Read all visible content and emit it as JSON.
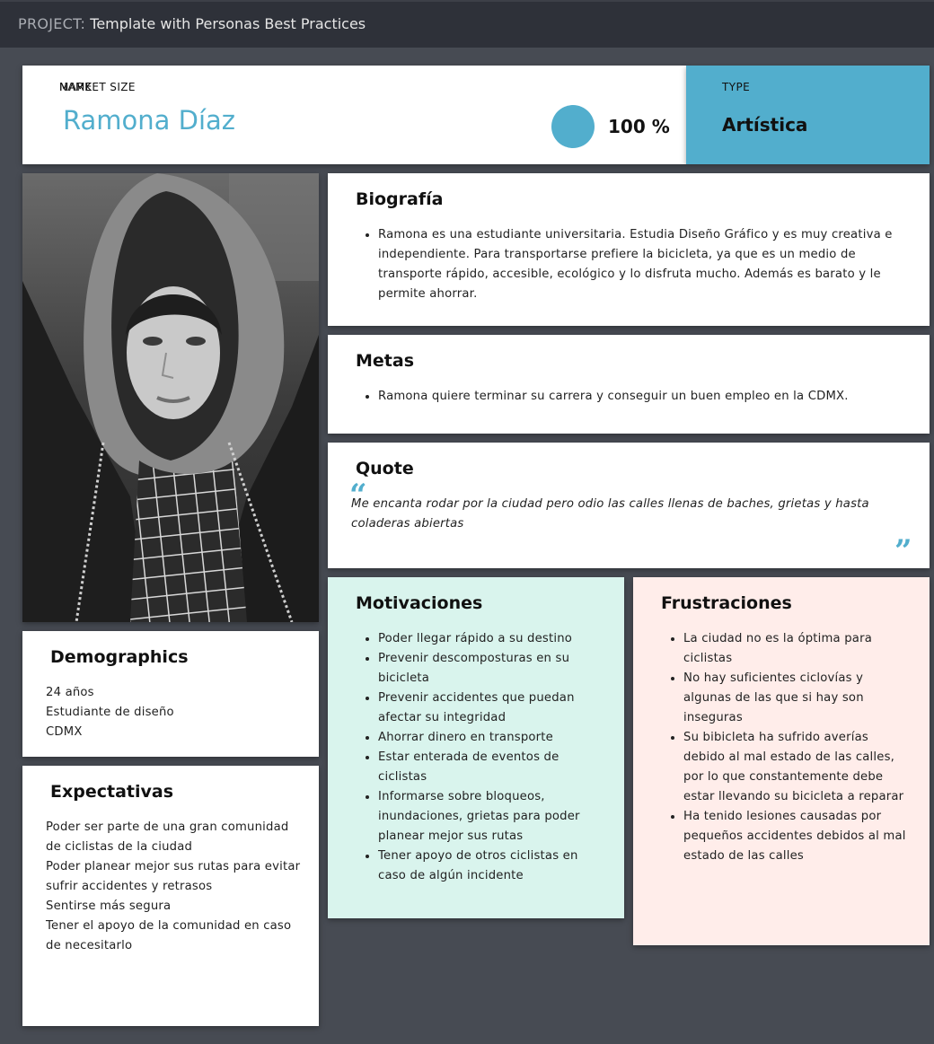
{
  "topbar": {
    "project_label": "PROJECT:",
    "project_name": "Template with Personas Best Practices"
  },
  "header": {
    "name_label": "NAME",
    "name": "Ramona Díaz",
    "market_size_label": "MARKET SIZE",
    "market_size_value": "100 %",
    "type_label": "TYPE",
    "type_value": "Artística"
  },
  "colors": {
    "accent": "#52aecd",
    "background": "#474b53",
    "topbar": "#2e3139",
    "motivaciones_bg": "#d9f4ed",
    "frustraciones_bg": "#ffedea"
  },
  "biografia": {
    "title": "Biografía",
    "items": [
      "Ramona es una estudiante universitaria. Estudia Diseño Gráfico y es muy creativa e independiente. Para transportarse prefiere la bicicleta, ya que es un medio de transporte rápido, accesible, ecológico y lo disfruta mucho. Además es barato y le permite ahorrar."
    ]
  },
  "metas": {
    "title": "Metas",
    "items": [
      "Ramona quiere terminar su carrera y conseguir un buen empleo en la CDMX."
    ]
  },
  "quote": {
    "title": "Quote",
    "text": "Me encanta rodar por la ciudad pero odio las calles llenas de baches, grietas y hasta coladeras abiertas",
    "open_mark": "“",
    "close_mark": "”"
  },
  "demographics": {
    "title": "Demographics",
    "lines": [
      "24 años",
      "Estudiante de diseño",
      "CDMX"
    ]
  },
  "expectativas": {
    "title": "Expectativas",
    "lines": [
      "Poder ser parte de una gran comunidad de ciclistas de la ciudad",
      "Poder planear mejor sus rutas para evitar sufrir accidentes y retrasos",
      "Sentirse más segura",
      "Tener el apoyo de la comunidad en caso de necesitarlo"
    ]
  },
  "motivaciones": {
    "title": "Motivaciones",
    "items": [
      "Poder llegar rápido a su destino",
      "Prevenir descomposturas en su bicicleta",
      "Prevenir accidentes que puedan afectar su integridad",
      "Ahorrar dinero en transporte",
      "Estar enterada de eventos de ciclistas",
      "Informarse sobre bloqueos, inundaciones, grietas para poder planear mejor sus rutas",
      "Tener apoyo de otros ciclistas en caso de algún incidente"
    ]
  },
  "frustraciones": {
    "title": "Frustraciones",
    "items": [
      "La ciudad no es la óptima para ciclistas",
      "No hay suficientes ciclovías y algunas de las que si hay son inseguras",
      "Su bibicleta ha sufrido averías debido al mal estado de las calles, por lo que constantemente debe estar llevando su bicicleta a reparar",
      "Ha tenido lesiones causadas por pequeños accidentes debidos al mal estado de las calles"
    ]
  }
}
